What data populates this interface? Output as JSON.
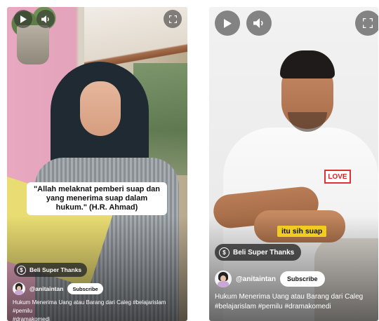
{
  "left_short": {
    "quote": "\"Allah melaknat pemberi suap dan yang menerima suap dalam hukum.\" (H.R. Ahmad)",
    "super_thanks_label": "Beli Super Thanks",
    "channel_handle": "@anitaintan",
    "subscribe_label": "Subscribe",
    "title_line1": "Hukum Menerima Uang atau Barang dari Caleg #belajarislam #pemilu",
    "title_line2": "#dramakomedi",
    "controls": {
      "play": "play-icon",
      "volume": "volume-icon",
      "fullscreen": "fullscreen-icon"
    }
  },
  "right_short": {
    "caption": "itu sih suap",
    "super_thanks_label": "Beli Super Thanks",
    "channel_handle": "@anitaintan",
    "subscribe_label": "Subscribe",
    "title_line1": "Hukum Menerima Uang atau Barang dari Caleg",
    "title_line2": "#belajarislam #pemilu #dramakomedi",
    "shirt_print": "LOVE",
    "controls": {
      "play": "play-icon",
      "volume": "volume-icon",
      "fullscreen": "fullscreen-icon"
    }
  },
  "colors": {
    "caption_highlight": "#f2cd1f",
    "overlay_button": "#282828",
    "subscribe_bg": "#ffffff"
  }
}
